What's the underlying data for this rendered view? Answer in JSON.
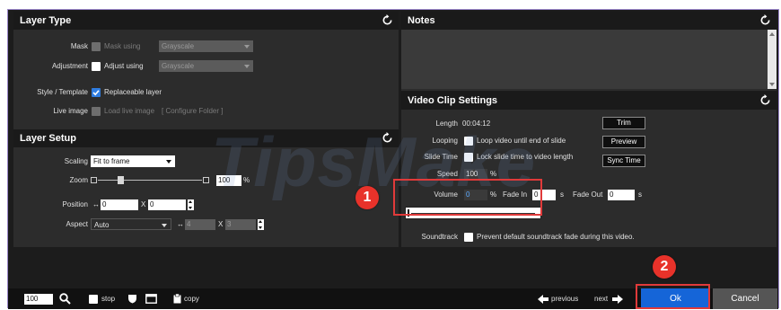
{
  "layer_type": {
    "title": "Layer Type",
    "mask_label": "Mask",
    "mask_check_label": "Mask using",
    "mask_select": "Grayscale",
    "adjustment_label": "Adjustment",
    "adjust_check_label": "Adjust using",
    "adjust_select": "Grayscale",
    "style_label": "Style / Template",
    "replaceable_label": "Replaceable layer",
    "live_image_label": "Live image",
    "load_live_label": "Load live image",
    "configure_folder": "[ Configure Folder ]"
  },
  "layer_setup": {
    "title": "Layer Setup",
    "scaling_label": "Scaling",
    "scaling_value": "Fit to frame",
    "zoom_label": "Zoom",
    "zoom_value": "100",
    "zoom_unit": "%",
    "position_label": "Position",
    "position_x": "0",
    "position_y": "0",
    "x_sep": "X",
    "aspect_label": "Aspect",
    "aspect_value": "Auto",
    "aspect_w": "4",
    "aspect_h": "3"
  },
  "notes": {
    "title": "Notes"
  },
  "video_clip": {
    "title": "Video Clip Settings",
    "length_label": "Length",
    "length_value": "00:04:12",
    "trim_button": "Trim",
    "looping_label": "Looping",
    "loop_check_label": "Loop video until end of slide",
    "preview_button": "Preview",
    "slide_time_label": "Slide Time",
    "lock_check_label": "Lock slide time to video length",
    "sync_button": "Sync Time",
    "speed_label": "Speed",
    "speed_value": "100",
    "speed_unit": "%",
    "volume_label": "Volume",
    "volume_value": "0",
    "volume_unit": "%",
    "fade_in_label": "Fade In",
    "fade_in_value": "0",
    "fade_in_unit": "s",
    "fade_out_label": "Fade Out",
    "fade_out_value": "0",
    "fade_out_unit": "s",
    "soundtrack_label": "Soundtrack",
    "soundtrack_check_label": "Prevent default soundtrack fade during this video."
  },
  "bottom_bar": {
    "zoom_value": "100",
    "stop_label": "stop",
    "copy_label": "copy",
    "previous_label": "previous",
    "next_label": "next",
    "ok_label": "Ok",
    "cancel_label": "Cancel"
  },
  "annotations": {
    "marker_1": "1",
    "marker_2": "2"
  },
  "watermark": "TipsMake",
  "colors": {
    "frame_border": "#9a86c9",
    "ok_blue": "#1565d8",
    "annotation_red": "#e8322a",
    "checkbox_blue": "#2f7de1"
  }
}
